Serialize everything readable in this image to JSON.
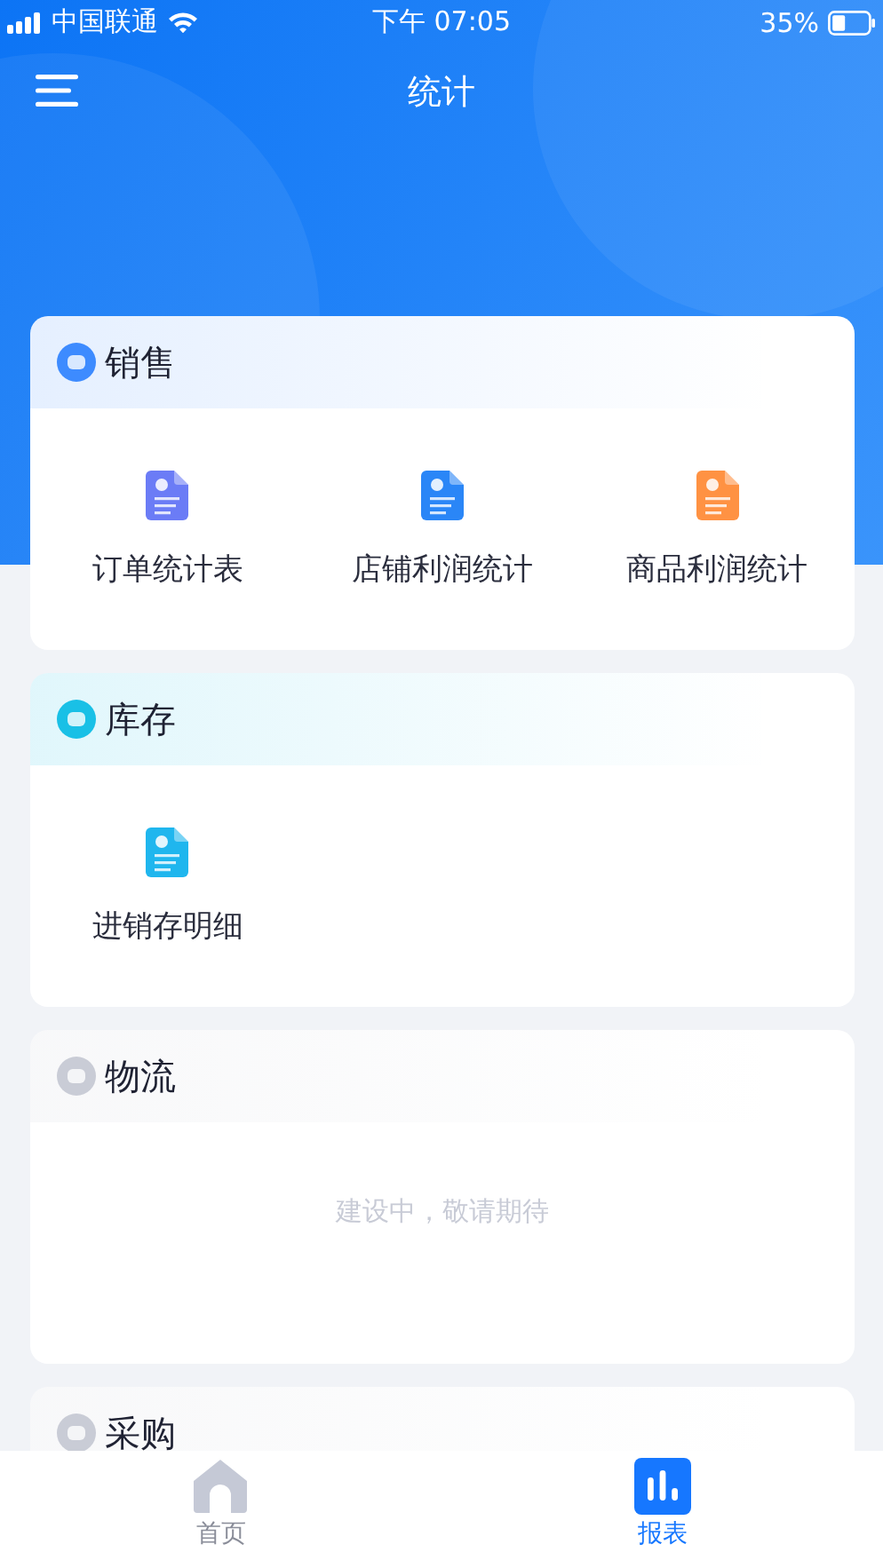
{
  "status_bar": {
    "carrier": "中国联通",
    "time": "下午 07:05",
    "battery": "35%"
  },
  "nav": {
    "title": "统计"
  },
  "sections": [
    {
      "title": "销售",
      "color": "#3d8bff",
      "kind": "grid",
      "items": [
        {
          "label": "订单统计表",
          "color": "#6b7cf6"
        },
        {
          "label": "店铺利润统计",
          "color": "#2a86f7"
        },
        {
          "label": "商品利润统计",
          "color": "#ff9243"
        }
      ]
    },
    {
      "title": "库存",
      "color": "#19c0e6",
      "kind": "grid",
      "items": [
        {
          "label": "进销存明细",
          "color": "#1fb6ee"
        }
      ]
    },
    {
      "title": "物流",
      "color": "#c9ccd6",
      "kind": "notice",
      "message": "建设中，敬请期待"
    },
    {
      "title": "采购",
      "color": "#c9ccd6",
      "kind": "notice"
    }
  ],
  "tabs": [
    {
      "label": "首页",
      "selected": false
    },
    {
      "label": "报表",
      "selected": true
    }
  ]
}
